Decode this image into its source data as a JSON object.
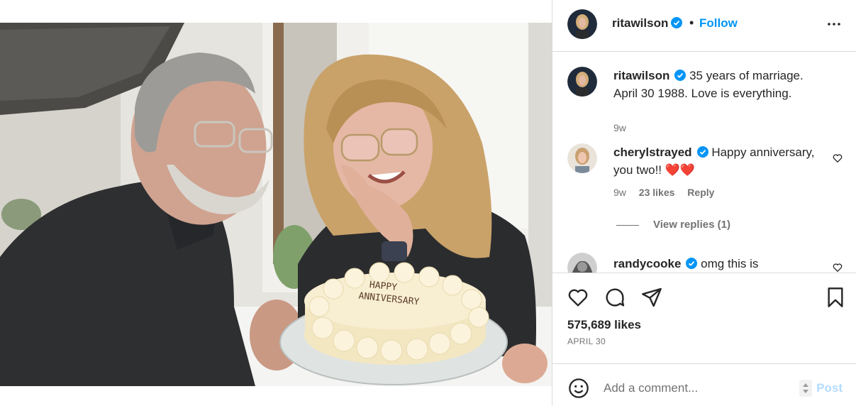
{
  "post": {
    "author": "ritawilson",
    "follow_label": "Follow",
    "separator": "•",
    "caption": "35 years of marriage. April 30 1988. Love is everything.",
    "caption_time": "9w",
    "likes": "575,689 likes",
    "date": "APRIL 30",
    "cake_text_line1": "HAPPY",
    "cake_text_line2": "ANNIVERSARY"
  },
  "comments": [
    {
      "username": "cherylstrayed",
      "text": "Happy anniversary, you two!! ❤️❤️",
      "time": "9w",
      "likes": "23 likes",
      "reply_label": "Reply",
      "view_replies": "View replies (1)"
    },
    {
      "username": "randycooke",
      "text": "omg this is"
    }
  ],
  "add_comment": {
    "placeholder": "Add a comment...",
    "post_label": "Post"
  },
  "colors": {
    "accent": "#0095f6",
    "verified": "#0095f6",
    "heart_red": "#ed4956",
    "post_disabled": "#b3dbff"
  },
  "icons": {
    "verified": "verified-badge-icon",
    "more": "more-options-icon",
    "like": "heart-icon",
    "comment": "comment-bubble-icon",
    "share": "paper-plane-icon",
    "save": "bookmark-icon",
    "emoji": "smiley-icon"
  }
}
